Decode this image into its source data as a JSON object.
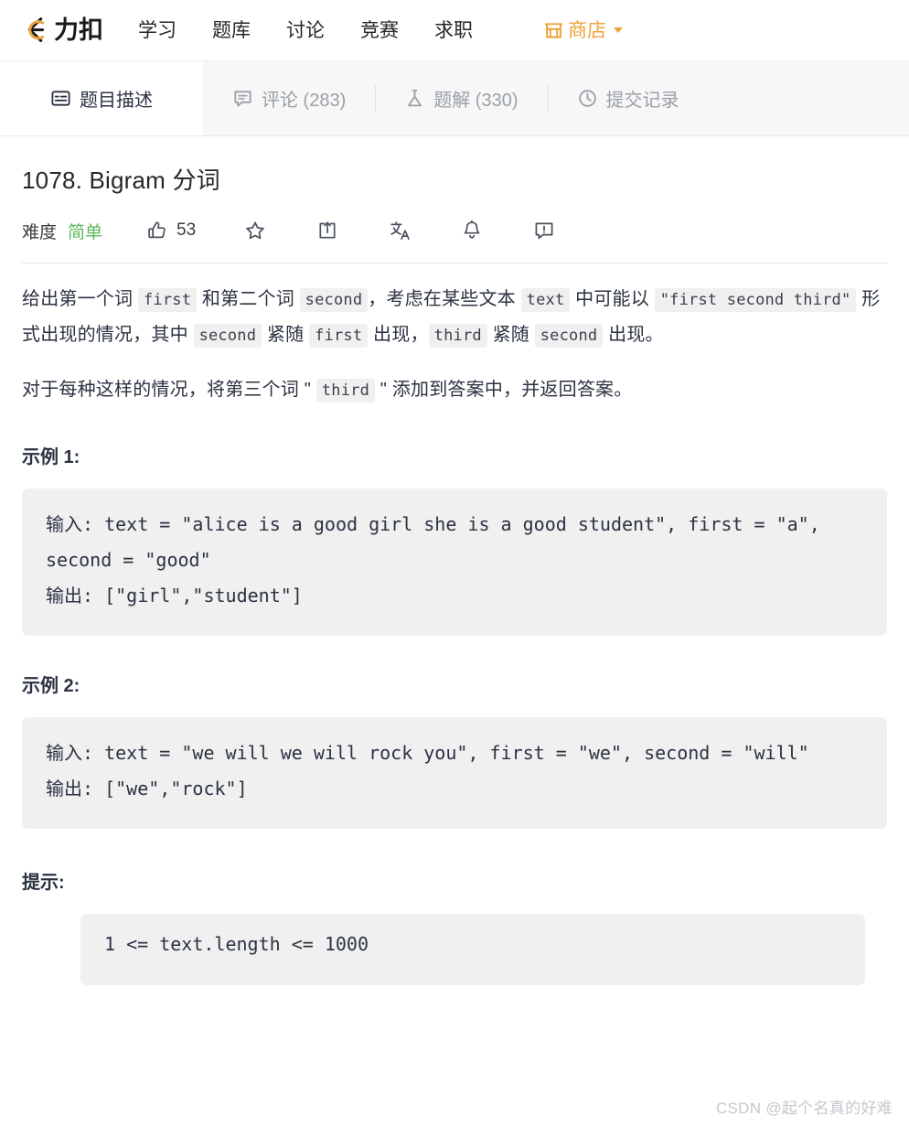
{
  "nav": {
    "logo_text": "力扣",
    "logo_icon": "leetcode-logo-icon",
    "items": [
      {
        "label": "学习",
        "name": "nav-item-study"
      },
      {
        "label": "题库",
        "name": "nav-item-problems"
      },
      {
        "label": "讨论",
        "name": "nav-item-discuss"
      },
      {
        "label": "竞赛",
        "name": "nav-item-contest"
      },
      {
        "label": "求职",
        "name": "nav-item-jobs"
      }
    ],
    "shop": {
      "label": "商店",
      "icon": "shop-icon",
      "chevron": "chevron-down-icon"
    },
    "accent_color": "#eda33b"
  },
  "tabs": [
    {
      "label": "题目描述",
      "icon": "description-icon",
      "active": true
    },
    {
      "label": "评论 (283)",
      "icon": "comment-icon",
      "active": false
    },
    {
      "label": "题解 (330)",
      "icon": "flask-icon",
      "active": false
    },
    {
      "label": "提交记录",
      "icon": "clock-icon",
      "active": false
    }
  ],
  "problem": {
    "title": "1078. Bigram 分词",
    "difficulty_label": "难度",
    "difficulty_value": "简单",
    "difficulty_color": "#5cb85c",
    "likes": "53",
    "actions": [
      {
        "name": "like-button",
        "icon": "thumbs-up-icon"
      },
      {
        "name": "favorite-button",
        "icon": "star-icon"
      },
      {
        "name": "share-button",
        "icon": "share-icon"
      },
      {
        "name": "translate-button",
        "icon": "translate-icon"
      },
      {
        "name": "notification-button",
        "icon": "bell-icon"
      },
      {
        "name": "report-button",
        "icon": "report-icon"
      }
    ]
  },
  "description": {
    "p1": {
      "t1": "给出第一个词 ",
      "c1": "first",
      "t2": " 和第二个词 ",
      "c2": "second",
      "t3": "，考虑在某些文本 ",
      "c3": "text",
      "t4": " 中可能以 ",
      "c4": "\"first second third\"",
      "t5": " 形式出现的情况，其中 ",
      "c5": "second",
      "t6": " 紧随 ",
      "c6": "first",
      "t7": " 出现，",
      "c7": "third",
      "t8": " 紧随 ",
      "c8": "second",
      "t9": " 出现。"
    },
    "p2": {
      "t1": "对于每种这样的情况，将第三个词 \" ",
      "c1": "third",
      "t2": " \" 添加到答案中，并返回答案。"
    }
  },
  "examples": [
    {
      "title": "示例 1:",
      "code": "输入: text = \"alice is a good girl she is a good student\", first = \"a\", second = \"good\"\n输出: [\"girl\",\"student\"]"
    },
    {
      "title": "示例 2:",
      "code": "输入: text = \"we will we will rock you\", first = \"we\", second = \"will\"\n输出: [\"we\",\"rock\"]"
    }
  ],
  "hints": {
    "title": "提示:",
    "code": "1 <= text.length <= 1000"
  },
  "watermark": "CSDN @起个名真的好难"
}
